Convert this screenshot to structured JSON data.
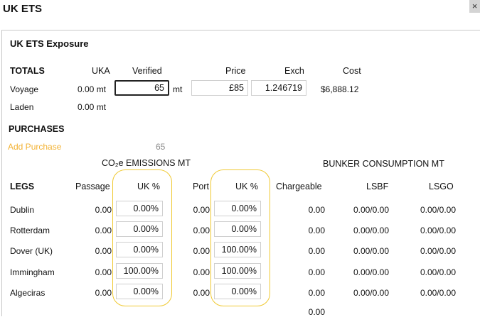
{
  "window": {
    "title": "UK ETS",
    "close_glyph": "×"
  },
  "panel": {
    "title": "UK ETS Exposure"
  },
  "totals": {
    "heading": "TOTALS",
    "col_uka": "UKA",
    "col_verified": "Verified",
    "col_price": "Price",
    "col_exch": "Exch",
    "col_cost": "Cost",
    "voyage": {
      "label": "Voyage",
      "uka": "0.00 mt",
      "verified": "65",
      "verified_unit": "mt",
      "price": "£85",
      "exch": "1.246719",
      "cost": "$6,888.12"
    },
    "laden": {
      "label": "Laden",
      "uka": "0.00 mt"
    }
  },
  "purchases": {
    "heading": "PURCHASES",
    "add_label": "Add Purchase",
    "total": "65"
  },
  "emissions_header": "CO₂e EMISSIONS MT",
  "bunker_header": "BUNKER CONSUMPTION MT",
  "legs_table": {
    "headers": {
      "legs": "LEGS",
      "passage": "Passage",
      "uk_pct_1": "UK %",
      "port": "Port",
      "uk_pct_2": "UK %",
      "chargeable": "Chargeable",
      "lsbf": "LSBF",
      "lsgo": "LSGO"
    },
    "rows": [
      {
        "name": "Dublin",
        "passage": "0.00",
        "uk1": "0.00%",
        "port": "0.00",
        "uk2": "0.00%",
        "chargeable": "0.00",
        "lsbf": "0.00/0.00",
        "lsgo": "0.00/0.00"
      },
      {
        "name": "Rotterdam",
        "passage": "0.00",
        "uk1": "0.00%",
        "port": "0.00",
        "uk2": "0.00%",
        "chargeable": "0.00",
        "lsbf": "0.00/0.00",
        "lsgo": "0.00/0.00"
      },
      {
        "name": "Dover (UK)",
        "passage": "0.00",
        "uk1": "0.00%",
        "port": "0.00",
        "uk2": "100.00%",
        "chargeable": "0.00",
        "lsbf": "0.00/0.00",
        "lsgo": "0.00/0.00"
      },
      {
        "name": "Immingham",
        "passage": "0.00",
        "uk1": "100.00%",
        "port": "0.00",
        "uk2": "100.00%",
        "chargeable": "0.00",
        "lsbf": "0.00/0.00",
        "lsgo": "0.00/0.00"
      },
      {
        "name": "Algeciras",
        "passage": "0.00",
        "uk1": "0.00%",
        "port": "0.00",
        "uk2": "0.00%",
        "chargeable": "0.00",
        "lsbf": "0.00/0.00",
        "lsgo": "0.00/0.00"
      }
    ],
    "chargeable_total": "0.00"
  },
  "highlight_color": "#f0c932",
  "link_color": "#f3b233"
}
